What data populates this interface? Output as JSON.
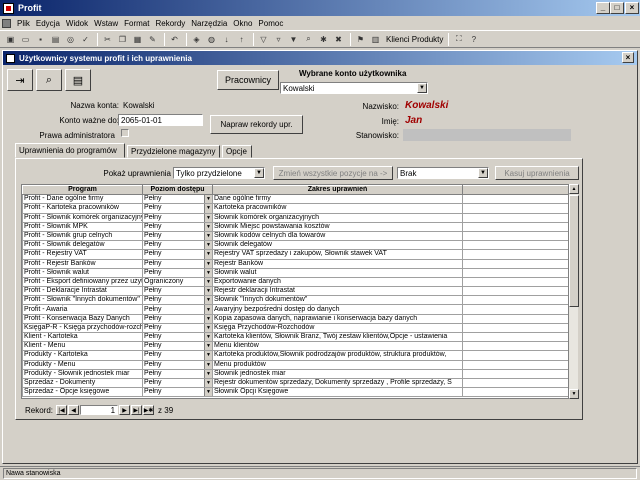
{
  "app": {
    "title": "Profit",
    "menu": [
      "Plik",
      "Edycja",
      "Widok",
      "Wstaw",
      "Format",
      "Rekordy",
      "Narzędzia",
      "Okno",
      "Pomoc"
    ],
    "toolbar_text": "Klienci Produkty"
  },
  "window": {
    "title": "Użytkownicy systemu profit i ich uprawnienia",
    "pracownicy_label": "Pracownicy",
    "wybrane_label": "Wybrane konto  użytkownika",
    "wybrane_value": "Kowalski",
    "nazwa_label": "Nazwa konta:",
    "nazwa_value": "Kowalski",
    "konto_label": "Konto ważne do:",
    "konto_value": "2065-01-01",
    "admin_label": "Prawa administratora",
    "napraw_label": "Napraw rekordy upr.",
    "nazwisko_label": "Nazwisko:",
    "nazwisko_value": "Kowalski",
    "imie_label": "Imię:",
    "imie_value": "Jan",
    "stanowisko_label": "Stanowisko:",
    "stanowisko_value": ""
  },
  "tabs": [
    "Uprawnienia do programów",
    "Przydzielone magazyny",
    "Opcje"
  ],
  "filter": {
    "pokaz_label": "Pokaż uprawnienia",
    "pokaz_value": "Tylko przydzielone",
    "zmien_label": "Zmień wszystkie pozycje na ->",
    "brak_value": "Brak",
    "kasuj_label": "Kasuj uprawnienia"
  },
  "grid": {
    "headers": [
      "Program",
      "Poziom dostępu",
      "Zakres uprawnień"
    ],
    "rows": [
      [
        "Profit - Dane ogólne firmy",
        "Pełny",
        "Dane ogólne firmy"
      ],
      [
        "Profit - Kartoteka pracowników",
        "Pełny",
        "Kartoteka pracowników"
      ],
      [
        "Profit - Słownik komórek organizacyjnych",
        "Pełny",
        "Słownik komórek organizacyjnych"
      ],
      [
        "Profit - Słownik MPK",
        "Pełny",
        "Słownik Miejsc powstawania kosztów"
      ],
      [
        "Profit - Słownik grup celnych",
        "Pełny",
        "Słownik kodów celnych dla towarów"
      ],
      [
        "Profit - Słownik delegatów",
        "Pełny",
        "Słownik delegatów"
      ],
      [
        "Profit - Rejestry VAT",
        "Pełny",
        "Rejestry VAT sprzedaży i zakupów, Słownik stawek VAT"
      ],
      [
        "Profit - Rejestr Banków",
        "Pełny",
        "Rejestr Banków"
      ],
      [
        "Profit - Słownik walut",
        "Pełny",
        "Słownik walut"
      ],
      [
        "Profit - Eksport definiowany przez użytk.",
        "Ograniczony",
        "Exportowanie danych"
      ],
      [
        "Profit - Deklaracje Intrastat",
        "Pełny",
        "Rejestr deklaracji Intrastat"
      ],
      [
        "Profit - Słownik \"Innych dokumentów\"",
        "Pełny",
        "Słownik \"Innych dokumentów\""
      ],
      [
        "Profit - Awaria",
        "Pełny",
        "Awaryjny bezpośredni dostęp do  danych"
      ],
      [
        "Profit - Konserwacja Bazy Danych",
        "Pełny",
        "Kopia zapasowa danych, naprawianie i konserwacja bazy danych"
      ],
      [
        "KsięgaP-R - Księga przychodów-rozchodów",
        "Pełny",
        "Księga Przychodów-Rozchodów"
      ],
      [
        "Klient - Kartoteka",
        "Pełny",
        "Kartoteka klientów, Słownik Branż, Twój zestaw klientów,Opcje - ustawienia"
      ],
      [
        "Klient - Menu",
        "Pełny",
        "Menu klientów"
      ],
      [
        "Produkty - Kartoteka",
        "Pełny",
        "Kartoteka produktów,Słownik podrodzajów produktów, struktura produktów,"
      ],
      [
        "Produkty - Menu",
        "Pełny",
        "Menu produktów"
      ],
      [
        "Produkty - Słownik jednostek miar",
        "Pełny",
        "Słownik jednostek miar"
      ],
      [
        "Sprzedaż - Dokumenty",
        "Pełny",
        "Rejestr dokumentów sprzedaży, Dokumenty sprzedaży , Profile sprzedaży, S"
      ],
      [
        "Sprzedaż - Opcje księgowe",
        "Pełny",
        "Słownik Opcji Księgowe"
      ]
    ]
  },
  "nav": {
    "label": "Rekord:",
    "current": "1",
    "total": "z 39"
  },
  "status": "Nawa stanowiska"
}
